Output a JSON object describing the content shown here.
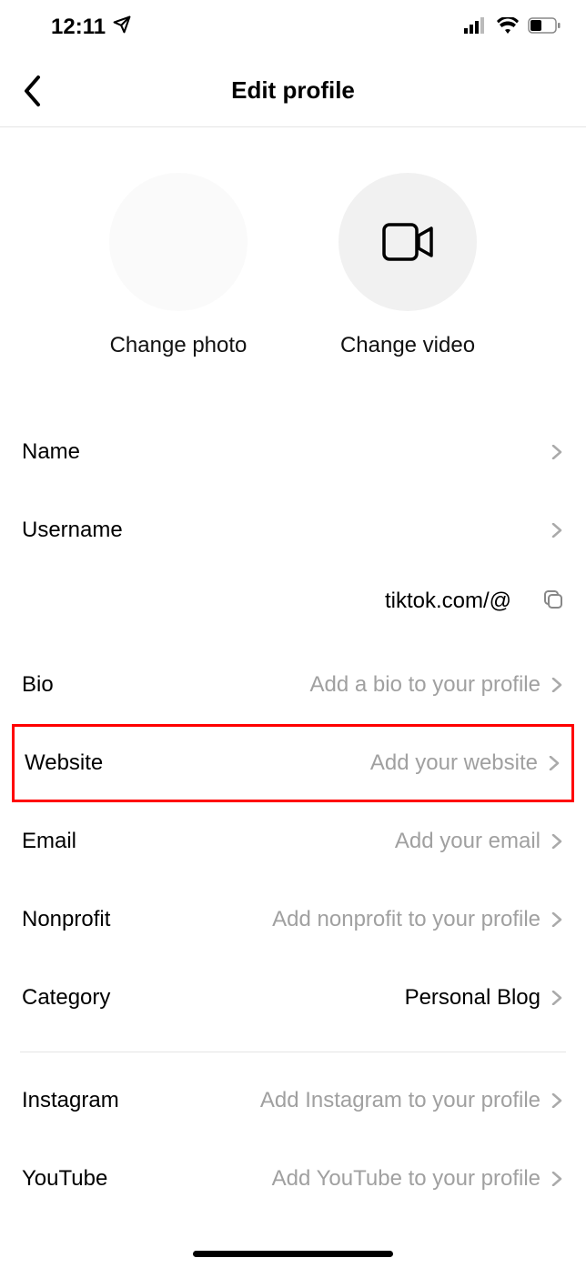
{
  "status": {
    "time": "12:11"
  },
  "header": {
    "title": "Edit profile"
  },
  "media": {
    "photo_label": "Change photo",
    "video_label": "Change video"
  },
  "rows": {
    "name": {
      "label": "Name",
      "value": ""
    },
    "username": {
      "label": "Username",
      "value": ""
    },
    "url_prefix": "tiktok.com/@",
    "bio": {
      "label": "Bio",
      "value": "Add a bio to your profile"
    },
    "website": {
      "label": "Website",
      "value": "Add your website"
    },
    "email": {
      "label": "Email",
      "value": "Add your email"
    },
    "nonprofit": {
      "label": "Nonprofit",
      "value": "Add nonprofit to your profile"
    },
    "category": {
      "label": "Category",
      "value": "Personal Blog"
    },
    "instagram": {
      "label": "Instagram",
      "value": "Add Instagram to your profile"
    },
    "youtube": {
      "label": "YouTube",
      "value": "Add YouTube to your profile"
    }
  }
}
